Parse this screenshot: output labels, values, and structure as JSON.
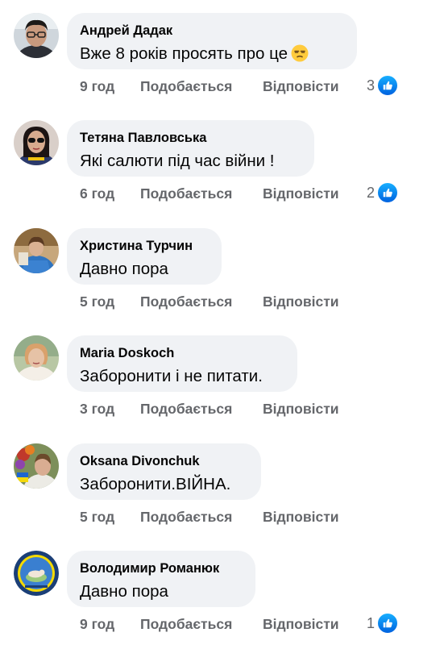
{
  "comments": [
    {
      "author": "Андрей Дадак",
      "text": "Вже 8 років просять про це",
      "emoji": "unamused-face-emoji",
      "time": "9 год",
      "like_label": "Подобається",
      "reply_label": "Відповісти",
      "reactions": "3",
      "avatar": "man-with-glasses-avatar"
    },
    {
      "author": "Тетяна Павловська",
      "text": "Які салюти під час війни !",
      "time": "6 год",
      "like_label": "Подобається",
      "reply_label": "Відповісти",
      "reactions": "2",
      "avatar": "woman-with-sunglasses-avatar"
    },
    {
      "author": "Христина Турчин",
      "text": "Давно пора",
      "time": "5 год",
      "like_label": "Подобається",
      "reply_label": "Відповісти",
      "reactions": "",
      "avatar": "woman-in-blue-avatar"
    },
    {
      "author": "Maria Doskoch",
      "text": "Заборонити і не питати.",
      "time": "3 год",
      "like_label": "Подобається",
      "reply_label": "Відповісти",
      "reactions": "",
      "avatar": "older-woman-avatar"
    },
    {
      "author": "Oksana Divonchuk",
      "text": "Заборонити.ВІЙНА.",
      "time": "5 год",
      "like_label": "Подобається",
      "reply_label": "Відповісти",
      "reactions": "",
      "avatar": "woman-with-flowers-avatar"
    },
    {
      "author": "Володимир Романюк",
      "text": "Давно пора",
      "time": "9 год",
      "like_label": "Подобається",
      "reply_label": "Відповісти",
      "reactions": "1",
      "avatar": "dog-badge-avatar"
    }
  ],
  "colors": {
    "bubble": "#f0f2f5",
    "meta_text": "#65676b",
    "like_blue": "#1877f2"
  }
}
